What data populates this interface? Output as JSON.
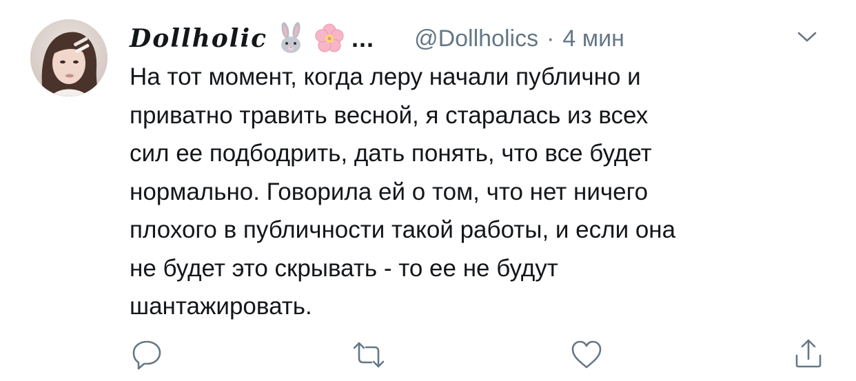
{
  "tweet": {
    "display_name": "Dollholic",
    "display_name_ellipsis": "...",
    "handle": "@Dollholics",
    "separator": "·",
    "timestamp": "4 мин",
    "emoji": [
      "rabbit-face",
      "cherry-blossom"
    ],
    "body_lines": [
      "На тот момент, когда леру начали публично и",
      "приватно травить весной, я старалась из всех",
      "сил ее подбодрить, дать понять, что все будет",
      "нормально. Говорила ей о том, что нет ничего",
      "плохого в публичности такой работы, и если она",
      "не будет это скрывать - то ее не будут",
      "шантажировать."
    ]
  },
  "actions": {
    "icons": [
      "reply-icon",
      "retweet-icon",
      "like-icon",
      "share-icon"
    ]
  },
  "colors": {
    "text": "#14171a",
    "secondary": "#657786",
    "icon": "#657786",
    "background": "#ffffff"
  }
}
